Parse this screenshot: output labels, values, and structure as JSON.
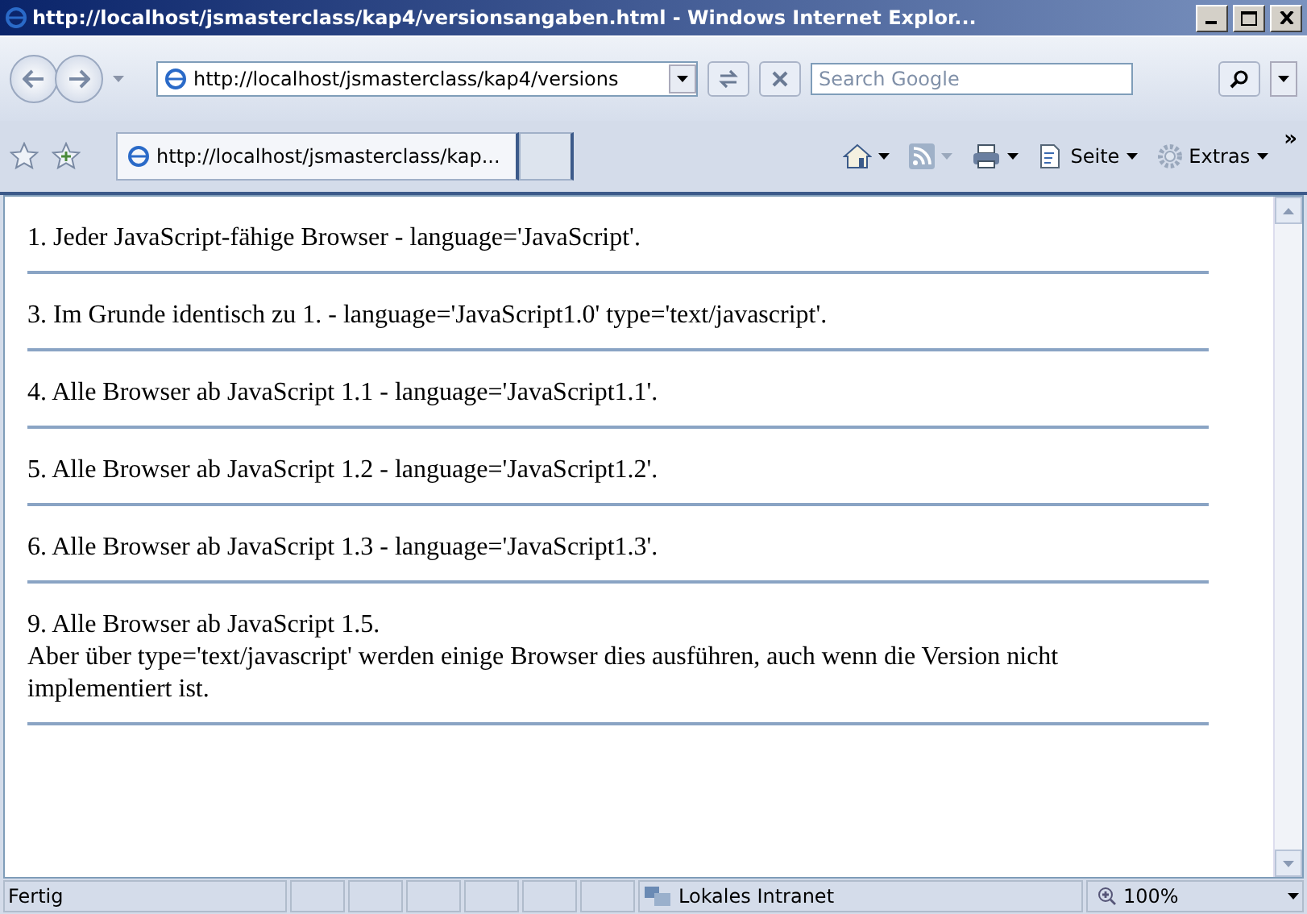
{
  "window": {
    "title": "http://localhost/jsmasterclass/kap4/versionsangaben.html - Windows Internet Explor..."
  },
  "address_bar": {
    "value": "http://localhost/jsmasterclass/kap4/versions"
  },
  "search": {
    "placeholder": "Search Google"
  },
  "tabs": [
    {
      "label": "http://localhost/jsmasterclass/kap...",
      "selected": true
    }
  ],
  "command_bar": [
    {
      "kind": "home"
    },
    {
      "kind": "feed"
    },
    {
      "kind": "print"
    },
    {
      "kind": "page",
      "label": "Seite"
    },
    {
      "kind": "tools",
      "label": "Extras"
    }
  ],
  "more_glyph": "»",
  "content": [
    {
      "lines": [
        "1. Jeder JavaScript-fähige Browser - language='JavaScript'."
      ]
    },
    {
      "lines": [
        "3. Im Grunde identisch zu 1. - language='JavaScript1.0' type='text/javascript'."
      ]
    },
    {
      "lines": [
        "4. Alle Browser ab JavaScript 1.1 - language='JavaScript1.1'."
      ]
    },
    {
      "lines": [
        "5. Alle Browser ab JavaScript 1.2 - language='JavaScript1.2'."
      ]
    },
    {
      "lines": [
        "6. Alle Browser ab JavaScript 1.3 - language='JavaScript1.3'."
      ]
    },
    {
      "lines": [
        "9. Alle Browser ab JavaScript 1.5.",
        "Aber über type='text/javascript' werden einige Browser dies ausführen, auch wenn die Version nicht implementiert ist."
      ]
    }
  ],
  "status_bar": {
    "status": "Fertig",
    "zone": "Lokales Intranet",
    "zoom": "100%"
  }
}
